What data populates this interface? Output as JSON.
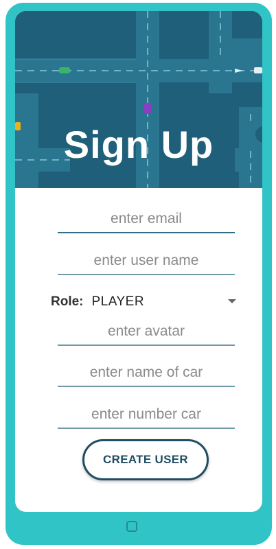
{
  "header": {
    "title": "Sign Up"
  },
  "form": {
    "email_placeholder": "enter email",
    "username_placeholder": "enter user name",
    "role_label": "Role:",
    "role_value": "PLAYER",
    "avatar_placeholder": "enter avatar",
    "car_name_placeholder": "enter name of car",
    "car_number_placeholder": "enter number car",
    "submit_label": "CREATE USER"
  },
  "colors": {
    "device_frame": "#31c4c6",
    "hero_background": "#1f5f7a",
    "accent": "#1f4d63"
  },
  "icons": {
    "role_dropdown": "caret-down-icon",
    "home": "home-square-icon"
  }
}
